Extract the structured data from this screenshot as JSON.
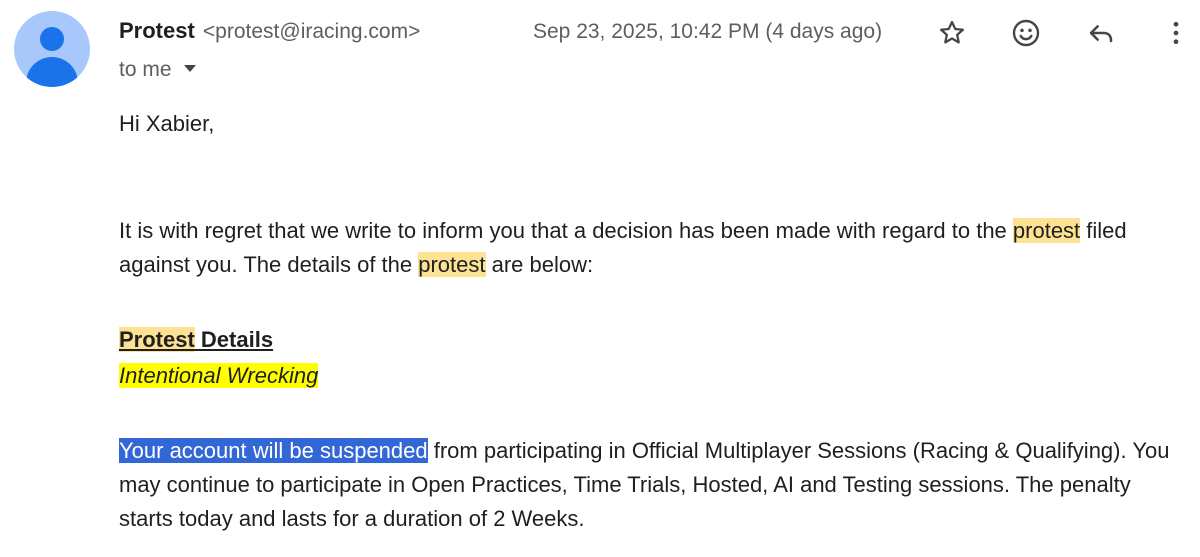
{
  "sender": {
    "name": "Protest",
    "email": "<protest@iracing.com>"
  },
  "recipient_label": "to me",
  "timestamp": "Sep 23, 2025, 10:42 PM (4 days ago)",
  "icons": {
    "star": "star-icon",
    "emoji": "emoji-icon",
    "reply": "reply-icon",
    "more": "more-vert-icon"
  },
  "colors": {
    "avatar_bg": "#a8c7fa",
    "avatar_fg": "#1a73e8",
    "search_highlight": "#fde293",
    "yellow_highlight": "#ffff00",
    "selection": "#3367d6"
  },
  "body": {
    "greeting": "Hi Xabier,",
    "para1_part1": "It is with regret that we write to inform you that a decision has been made with regard to the ",
    "para1_hl1": "protest",
    "para1_part2": " filed against you. The details of the ",
    "para1_hl2": "protest",
    "para1_part3": " are below:",
    "details_title_hl": "Protest",
    "details_title_rest": " Details",
    "reason": "Intentional Wrecking ",
    "para2_selected": "Your account will be suspended",
    "para2_rest": " from participating in Official Multiplayer Sessions (Racing & Qualifying). You may continue to participate in Open Practices, Time Trials, Hosted, AI and Testing sessions. The penalty starts today and lasts for a duration of 2 Weeks."
  }
}
